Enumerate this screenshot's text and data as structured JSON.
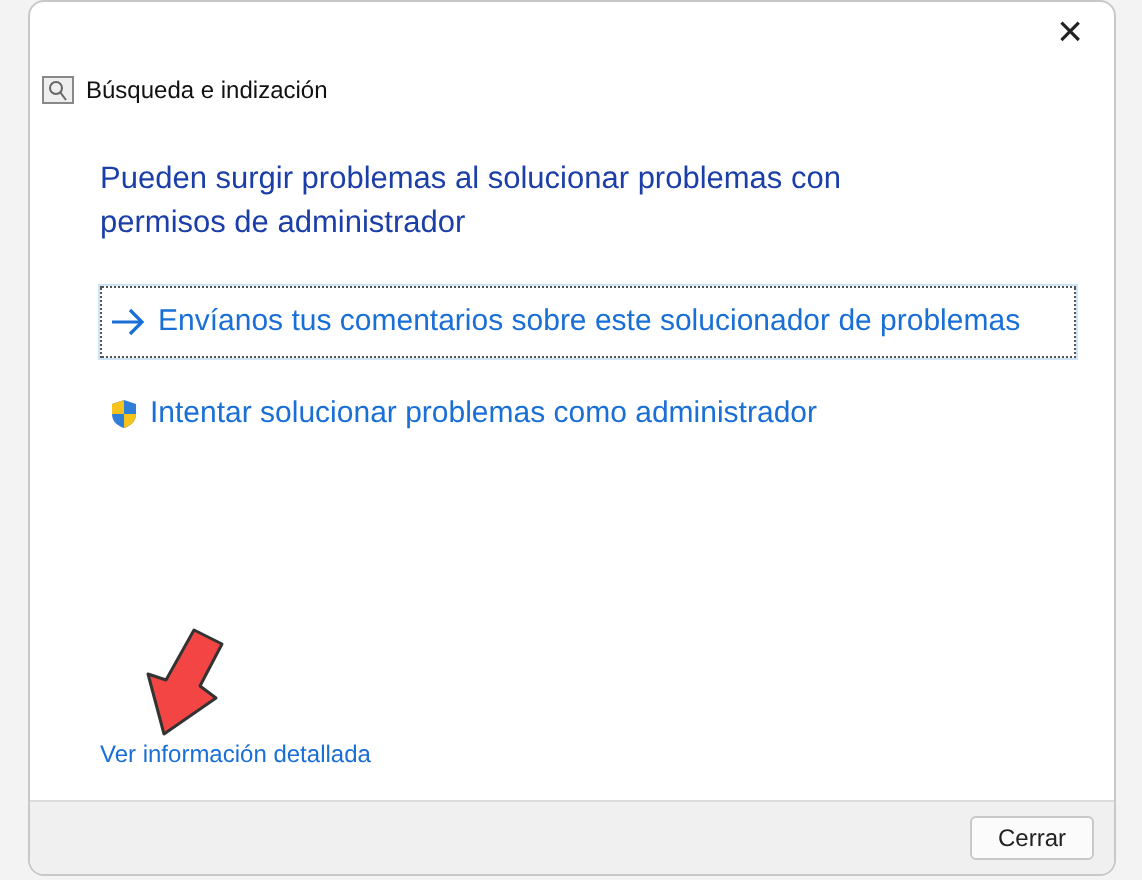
{
  "window": {
    "title": "Búsqueda e indización",
    "close": "×"
  },
  "heading": "Pueden surgir problemas al solucionar problemas con permisos de administrador",
  "options": [
    {
      "kind": "feedback",
      "label": "Envíanos tus comentarios sobre este solucionador de problemas",
      "focused": true
    },
    {
      "kind": "admin",
      "label": "Intentar solucionar problemas como administrador",
      "focused": false
    }
  ],
  "details_link": "Ver información detallada",
  "buttons": [
    {
      "label": "Cerrar"
    }
  ]
}
